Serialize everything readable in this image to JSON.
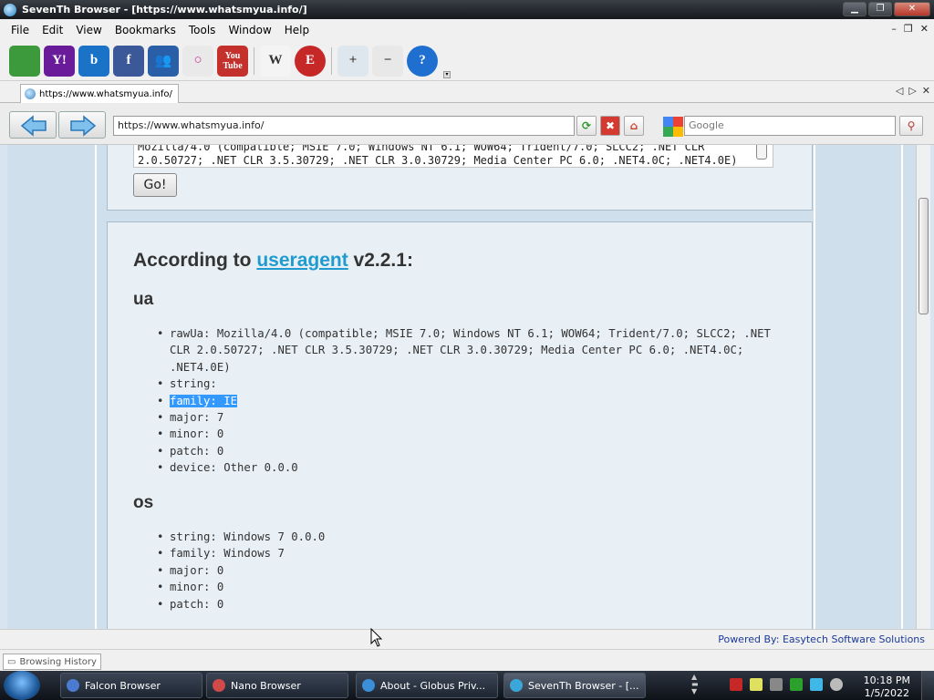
{
  "window": {
    "title": "SevenTh Browser - [https://www.whatsmyua.info/]",
    "min": "▁",
    "max": "❐",
    "close": "✕"
  },
  "menubar": {
    "items": [
      "File",
      "Edit",
      "View",
      "Bookmarks",
      "Tools",
      "Window",
      "Help"
    ],
    "mdi_min": "–",
    "mdi_restore": "❐",
    "mdi_close": "✕"
  },
  "toolbar": {
    "icons": [
      {
        "name": "google-maps-icon",
        "glyph": "",
        "color": "#3c9a3c"
      },
      {
        "name": "yahoo-icon",
        "glyph": "Y!",
        "color": "#6a1b9a"
      },
      {
        "name": "bing-icon",
        "glyph": "b",
        "color": "#1a73c7"
      },
      {
        "name": "facebook-icon",
        "glyph": "f",
        "color": "#3b5998"
      },
      {
        "name": "myspace-icon",
        "glyph": "👥",
        "color": "#2a5fa8"
      },
      {
        "name": "orkut-icon",
        "glyph": "○",
        "color": "#e9e9e9"
      },
      {
        "name": "youtube-icon",
        "glyph": "You Tube",
        "color": "#c4302b"
      },
      {
        "name": "wikipedia-icon",
        "glyph": "W",
        "color": "#f4f4f4"
      },
      {
        "name": "eset-icon",
        "glyph": "E",
        "color": "#c62828"
      },
      {
        "name": "add-bookmark-icon",
        "glyph": "+",
        "color": "#dfe7ee"
      },
      {
        "name": "remove-bookmark-icon",
        "glyph": "−",
        "color": "#e8e8e8"
      },
      {
        "name": "help-icon",
        "glyph": "?",
        "color": "#1f6fd0"
      }
    ]
  },
  "tab": {
    "label": "https://www.whatsmyua.info/"
  },
  "tabctl": {
    "prev": "◁",
    "next": "▷",
    "close": "✕"
  },
  "nav": {
    "url": "https://www.whatsmyua.info/",
    "search_placeholder": "Google",
    "refresh": "⟳",
    "stop": "✖",
    "home": "⌂",
    "search_go": "⚲"
  },
  "page": {
    "ua_textarea": "Mozilla/4.0 (compatible; MSIE 7.0; Windows NT 6.1; WOW64; Trident/7.0; SLCC2; .NET CLR 2.0.50727; .NET CLR 3.5.30729; .NET CLR 3.0.30729; Media Center PC 6.0; .NET4.0C; .NET4.0E)",
    "go_button": "Go!",
    "heading_prefix": "According to ",
    "heading_link": "useragent",
    "heading_suffix": " v2.2.1:",
    "ua_heading": "ua",
    "ua_items": [
      "rawUa: Mozilla/4.0 (compatible; MSIE 7.0; Windows NT 6.1; WOW64; Trident/7.0; SLCC2; .NET CLR 2.0.50727; .NET CLR 3.5.30729; .NET CLR 3.0.30729; Media Center PC 6.0; .NET4.0C; .NET4.0E)",
      "string:",
      "family: IE",
      "major: 7",
      "minor: 0",
      "patch: 0",
      "device: Other 0.0.0"
    ],
    "os_heading": "os",
    "os_items": [
      "string: Windows 7 0.0.0",
      "family: Windows 7",
      "major: 0",
      "minor: 0",
      "patch: 0"
    ]
  },
  "status": {
    "powered": "Powered By: Easytech Software Solutions"
  },
  "history": {
    "label": "Browsing History"
  },
  "taskbar": {
    "tasks": [
      {
        "label": "Falcon Browser",
        "color": "#4a7bd0"
      },
      {
        "label": "Nano Browser",
        "color": "#d04a4a"
      },
      {
        "label": "About - Globus Priv...",
        "color": "#3b8fd8"
      },
      {
        "label": "SevenTh Browser - [...",
        "color": "#3aa7d8"
      }
    ],
    "time": "10:18 PM",
    "date": "1/5/2022"
  }
}
